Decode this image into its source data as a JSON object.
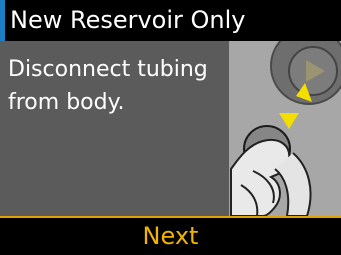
{
  "header": {
    "title": "New Reservoir Only",
    "accent_color": "#1c7fc4"
  },
  "main": {
    "instruction": "Disconnect tubing from body."
  },
  "illustration": {
    "icon": "disconnect-tubing-illustration-icon"
  },
  "footer": {
    "button_label": "Next",
    "accent_color": "#e0a300"
  }
}
